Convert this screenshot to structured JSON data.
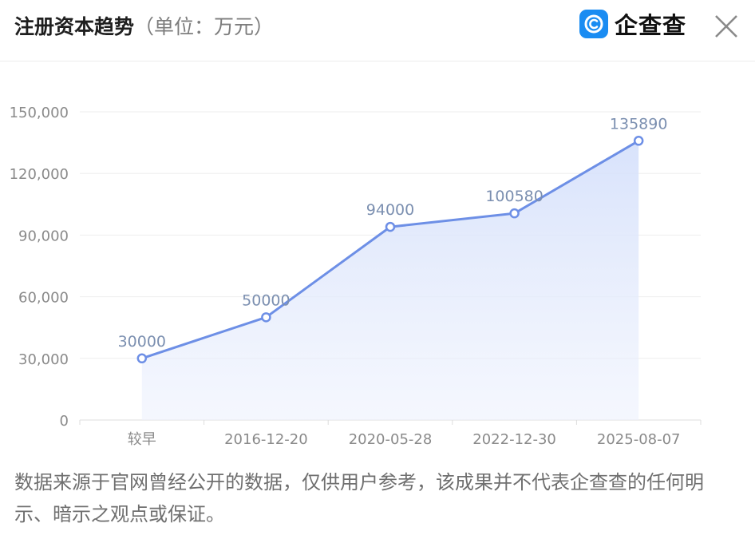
{
  "header": {
    "title": "注册资本趋势",
    "unit": "（单位：万元）",
    "brand": "企查查"
  },
  "colors": {
    "line": "#6d8fe6",
    "area_top": "#dde6fb",
    "grid": "#eeeeee",
    "axis_text": "#8a8a8a",
    "label_text": "#7b8fb0"
  },
  "chart_data": {
    "type": "area",
    "categories": [
      "较早",
      "2016-12-20",
      "2020-05-28",
      "2022-12-30",
      "2025-08-07"
    ],
    "series": [
      {
        "values": [
          30000,
          50000,
          94000,
          100580,
          135890
        ]
      }
    ],
    "ylim": [
      0,
      150000
    ],
    "yticks": [
      0,
      30000,
      60000,
      90000,
      120000,
      150000
    ],
    "ytick_labels": [
      "0",
      "30,000",
      "60,000",
      "90,000",
      "120,000",
      "150,000"
    ],
    "data_labels": [
      "30000",
      "50000",
      "94000",
      "100580",
      "135890"
    ],
    "grid": true
  },
  "footnote": "数据来源于官网曾经公开的数据，仅供用户参考，该成果并不代表企查查的任何明示、暗示之观点或保证。"
}
